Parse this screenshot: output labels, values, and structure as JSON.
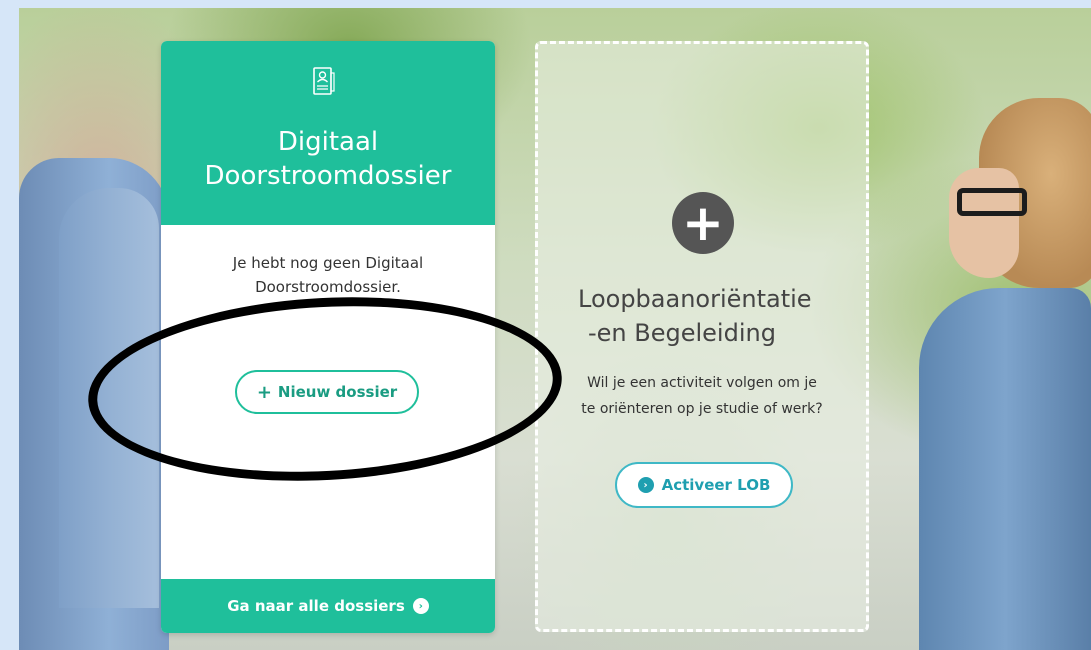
{
  "ddd_card": {
    "title_line1": "Digitaal",
    "title_line2": "Doorstroomdossier",
    "message_line1": "Je hebt nog geen Digitaal",
    "message_line2": "Doorstroomdossier.",
    "new_button": {
      "icon": "+",
      "label": "Nieuw dossier"
    },
    "footer_link": {
      "label": "Ga naar alle dossiers",
      "icon": "›"
    },
    "icon": "document-icon"
  },
  "lob_card": {
    "icon": "+",
    "title_line1": "Loopbaanoriëntatie",
    "title_line2": "-en Begeleiding",
    "desc_line1": "Wil je een activiteit volgen om je",
    "desc_line2": "te oriënteren op je studie of werk?",
    "button": {
      "icon": "›",
      "label": "Activeer LOB"
    }
  },
  "colors": {
    "accent": "#1fbf9b",
    "lob_accent": "#1f9fb0",
    "page_border": "#d6e6f8"
  }
}
